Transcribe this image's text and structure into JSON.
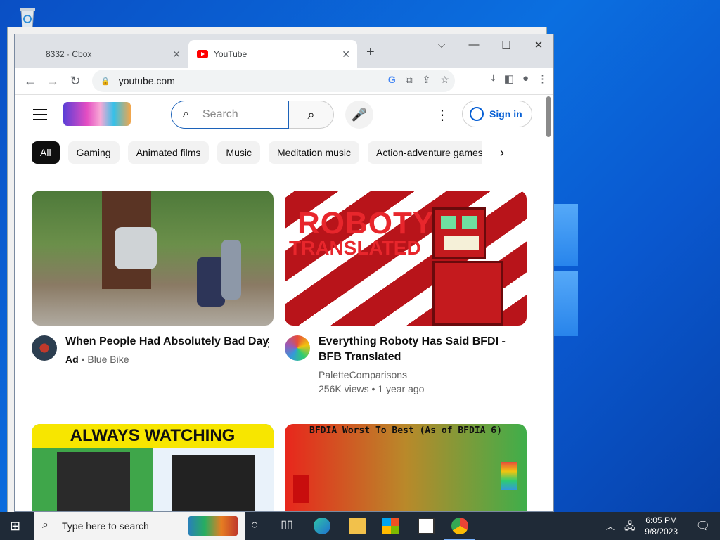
{
  "browser": {
    "tabs": [
      {
        "label": "8332 · Cbox"
      },
      {
        "label": "YouTube"
      }
    ],
    "url": "youtube.com"
  },
  "youtube": {
    "search_placeholder": "Search",
    "sign_in": "Sign in",
    "chips": [
      "All",
      "Gaming",
      "Animated films",
      "Music",
      "Meditation music",
      "Action-adventure games"
    ],
    "videos": [
      {
        "title": "When People Had Absolutely Bad Day",
        "ad_badge": "Ad",
        "channel": "Blue Bike"
      },
      {
        "title_line1": "Everything Roboty Has Said BFDI -",
        "title_line2": "BFB Translated",
        "channel": "PaletteComparisons",
        "views_age": "256K views • 1 year ago",
        "thumb_text1": "ROBOTY",
        "thumb_text2": "TRANSLATED"
      },
      {
        "thumb_text": "ALWAYS WATCHING"
      },
      {
        "thumb_text": "BFDIA Worst To Best (As of BFDIA 6)"
      }
    ]
  },
  "taskbar": {
    "search_placeholder": "Type here to search",
    "time": "6:05 PM",
    "date": "9/8/2023"
  }
}
